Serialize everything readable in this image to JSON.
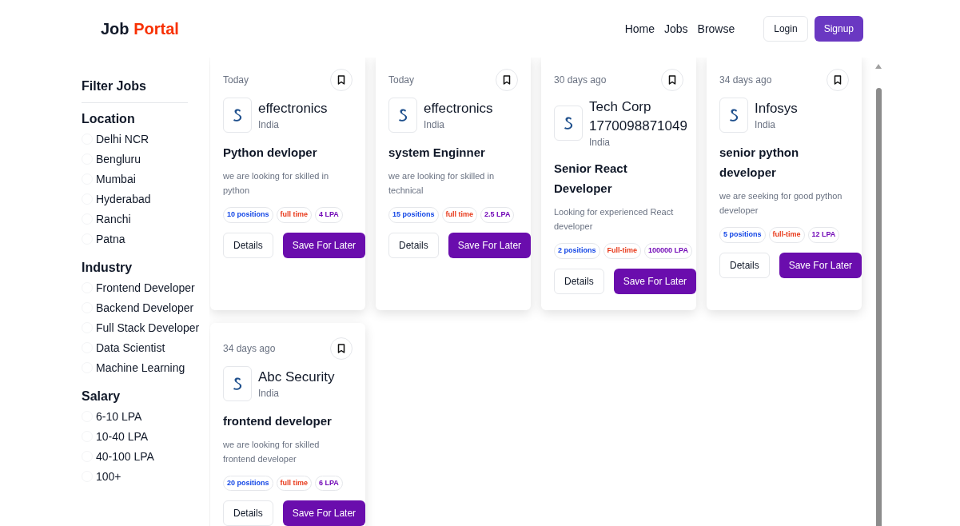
{
  "logo": {
    "first": "Job",
    "second": "Portal"
  },
  "nav": {
    "links": [
      "Home",
      "Jobs",
      "Browse"
    ],
    "login": "Login",
    "signup": "Signup"
  },
  "filter": {
    "title": "Filter Jobs",
    "groups": [
      {
        "name": "Location",
        "options": [
          {
            "label": "Delhi NCR",
            "selected": false
          },
          {
            "label": "Bengluru",
            "selected": false
          },
          {
            "label": "Mumbai",
            "selected": false
          },
          {
            "label": "Hyderabad",
            "selected": false
          },
          {
            "label": "Ranchi",
            "selected": false
          },
          {
            "label": "Patna",
            "selected": false
          }
        ]
      },
      {
        "name": "Industry",
        "options": [
          {
            "label": "Frontend Developer",
            "selected": false
          },
          {
            "label": "Backend Developer",
            "selected": false
          },
          {
            "label": "Full Stack Developer",
            "selected": false
          },
          {
            "label": "Data Scientist",
            "selected": false
          },
          {
            "label": "Machine Learning",
            "selected": false
          }
        ]
      },
      {
        "name": "Salary",
        "options": [
          {
            "label": "6-10 LPA",
            "selected": false
          },
          {
            "label": "10-40 LPA",
            "selected": false
          },
          {
            "label": "40-100 LPA",
            "selected": false
          },
          {
            "label": "100+",
            "selected": false
          }
        ]
      }
    ]
  },
  "jobs": [
    {
      "posted": "Today",
      "company": "effectronics",
      "location": "India",
      "title": "Python devloper",
      "description": "we are looking for skilled in python",
      "positions": "10 positions",
      "type": "full time",
      "salary": "4 LPA",
      "details": "Details",
      "save": "Save For Later"
    },
    {
      "posted": "Today",
      "company": "effectronics",
      "location": "India",
      "title": "system Enginner",
      "description": "we are looking for skilled in technical",
      "positions": "15 positions",
      "type": "full time",
      "salary": "2.5 LPA",
      "details": "Details",
      "save": "Save For Later"
    },
    {
      "posted": "30 days ago",
      "company": "Tech Corp 1770098871049",
      "location": "India",
      "title": "Senior React Developer",
      "description": "Looking for experienced React developer",
      "positions": "2 positions",
      "type": "Full-time",
      "salary": "100000 LPA",
      "details": "Details",
      "save": "Save For Later"
    },
    {
      "posted": "34 days ago",
      "company": "Infosys",
      "location": "India",
      "title": "senior python developer",
      "description": "we are seeking for good python developer",
      "positions": "5 positions",
      "type": "full-time",
      "salary": "12 LPA",
      "details": "Details",
      "save": "Save For Later"
    },
    {
      "posted": "34 days ago",
      "company": "Abc Security",
      "location": "India",
      "title": "frontend developer",
      "description": "we are looking for skilled frontend developer",
      "positions": "20 positions",
      "type": "full time",
      "salary": "6 LPA",
      "details": "Details",
      "save": "Save For Later"
    }
  ]
}
